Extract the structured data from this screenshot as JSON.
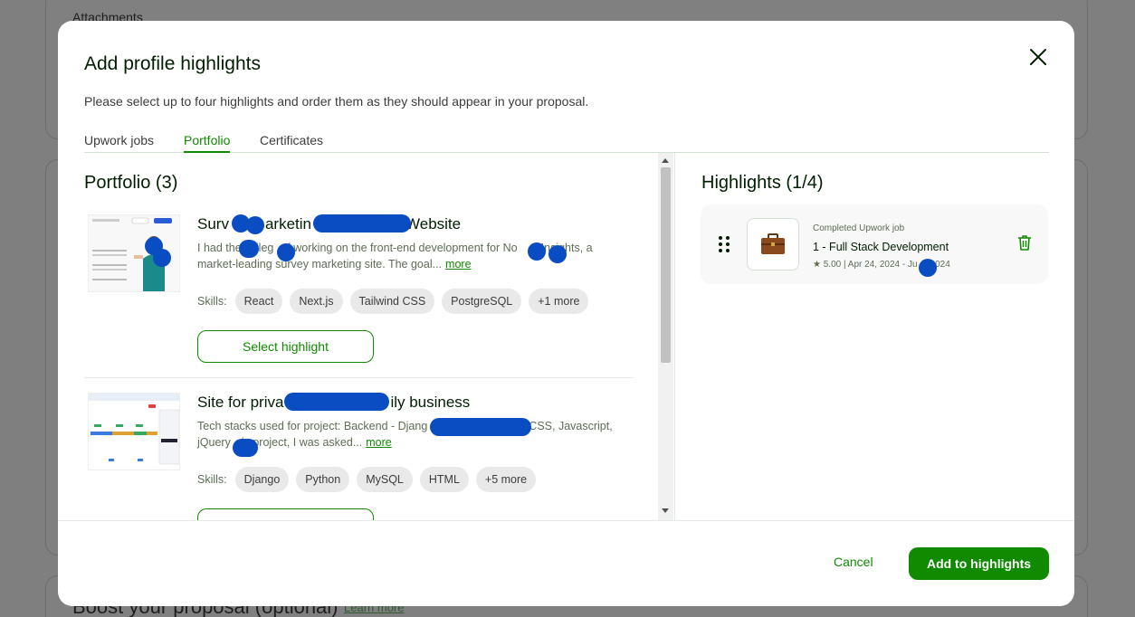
{
  "background": {
    "attachments_label": "Attachments",
    "boost_label": "Boost your proposal (optional)",
    "learn_more": "Learn more"
  },
  "modal": {
    "title": "Add profile highlights",
    "subtitle": "Please select up to four highlights and order them as they should appear in your proposal.",
    "close_icon": "close-icon",
    "tabs": [
      {
        "label": "Upwork jobs",
        "active": false
      },
      {
        "label": "Portfolio",
        "active": true
      },
      {
        "label": "Certificates",
        "active": false
      }
    ]
  },
  "portfolio": {
    "title": "Portfolio (3)",
    "skills_label": "Skills:",
    "more_link": "more",
    "select_label": "Select highlight",
    "items": [
      {
        "name_start": "Surv",
        "name_mid": "arketin",
        "name_end": "Website",
        "desc_line1_a": "I had the",
        "desc_line1_b": "vileg",
        "desc_line1_c": "of working on the front-end development for No",
        "desc_line1_d": "Insights, a",
        "desc_line2": "market-leading survey marketing site. The goal...",
        "skills": [
          "React",
          "Next.js",
          "Tailwind CSS",
          "PostgreSQL",
          "+1 more"
        ]
      },
      {
        "name_start": "Site for priva",
        "name_end": "ily business",
        "desc_line1_a": "Tech stacks used for project: Backend - Djang",
        "desc_line1_b": "CSS, Javascript,",
        "desc_line2_a": "jQuery",
        "desc_line2_b": "is project, I was asked...",
        "skills": [
          "Django",
          "Python",
          "MySQL",
          "HTML",
          "+5 more"
        ]
      }
    ]
  },
  "highlights": {
    "title": "Highlights (1/4)",
    "items": [
      {
        "type": "Completed Upwork job",
        "name": "1 - Full Stack Development",
        "meta_a": "★ 5.00 | Apr 24, 2024 - Ju",
        "meta_b": "2024",
        "icon": "briefcase-icon"
      }
    ]
  },
  "footer": {
    "cancel_label": "Cancel",
    "add_label": "Add to highlights"
  },
  "colors": {
    "accent": "#108a00",
    "redaction": "#0a4cc2"
  }
}
